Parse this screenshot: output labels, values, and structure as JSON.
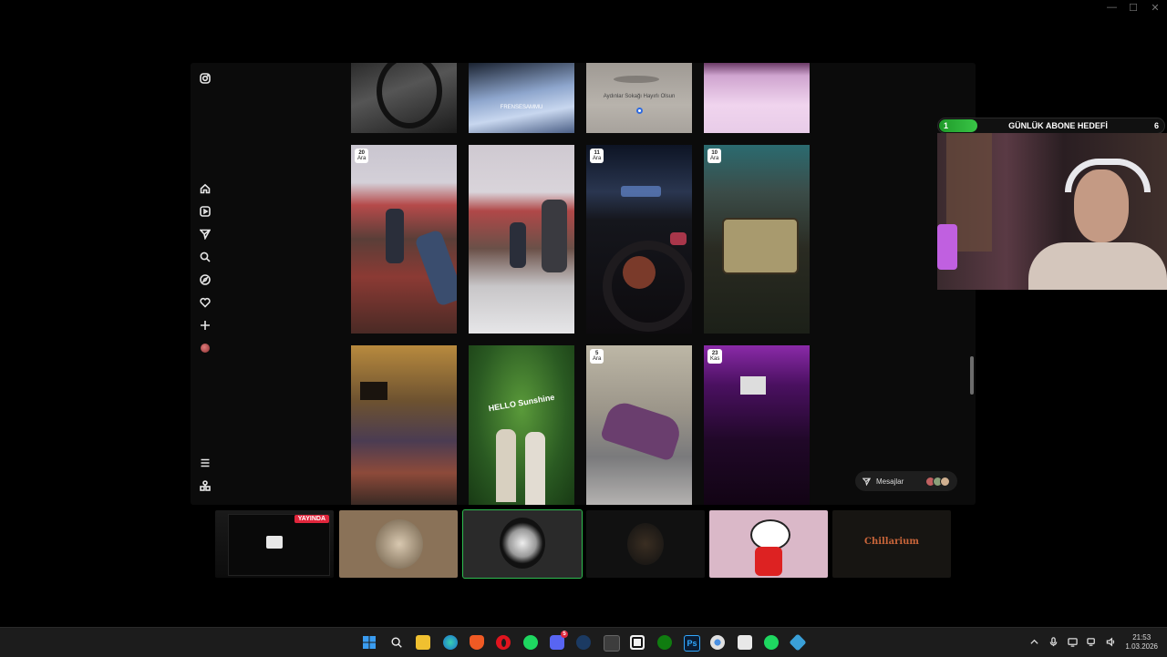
{
  "window_controls": {
    "minimize": "—",
    "maximize": "☐",
    "close": "✕"
  },
  "instagram": {
    "sidebar": {
      "logo_icon": "instagram-icon",
      "items": [
        {
          "icon": "home-icon"
        },
        {
          "icon": "reels-icon"
        },
        {
          "icon": "send-icon"
        },
        {
          "icon": "search-icon"
        },
        {
          "icon": "explore-icon"
        },
        {
          "icon": "heart-icon"
        },
        {
          "icon": "plus-icon"
        },
        {
          "icon": "profile-avatar"
        }
      ],
      "bottom": [
        {
          "icon": "menu-icon"
        },
        {
          "icon": "meta-icon"
        }
      ]
    },
    "posts": [
      {
        "caption": "",
        "date_day": "",
        "date_month": ""
      },
      {
        "caption": "FRENSESAMMU",
        "date_day": "",
        "date_month": ""
      },
      {
        "caption": "Aydınlar Sokağı Hayırlı Olsun",
        "date_day": "",
        "date_month": ""
      },
      {
        "caption": "",
        "date_day": "",
        "date_month": ""
      },
      {
        "caption": "",
        "date_day": "20",
        "date_month": "Ara"
      },
      {
        "caption": "",
        "date_day": "",
        "date_month": ""
      },
      {
        "caption": "",
        "date_day": "11",
        "date_month": "Ara"
      },
      {
        "caption": "",
        "date_day": "10",
        "date_month": "Ara"
      },
      {
        "caption": "",
        "date_day": "",
        "date_month": ""
      },
      {
        "caption": "HELLO Sunshine",
        "date_day": "",
        "date_month": ""
      },
      {
        "caption": "",
        "date_day": "5",
        "date_month": "Ara"
      },
      {
        "caption": "",
        "date_day": "23",
        "date_month": "Kas"
      }
    ],
    "messages": {
      "label": "Mesajlar",
      "icon": "send-icon"
    }
  },
  "webcam": {
    "subgoal": {
      "current": "1",
      "title": "GÜNLÜK ABONE HEDEFİ",
      "target": "6",
      "progress": 0.17
    }
  },
  "stream_thumbnails": [
    {
      "live_label": "YAYINDA",
      "selected": false,
      "text": ""
    },
    {
      "live_label": "",
      "selected": false,
      "text": ""
    },
    {
      "live_label": "",
      "selected": true,
      "text": ""
    },
    {
      "live_label": "",
      "selected": false,
      "text": ""
    },
    {
      "live_label": "",
      "selected": false,
      "text": ""
    },
    {
      "live_label": "",
      "selected": false,
      "text": "Chillarium"
    }
  ],
  "taskbar": {
    "apps": [
      "windows-start-icon",
      "search-icon",
      "file-explorer-icon",
      "edge-icon",
      "brave-icon",
      "opera-icon",
      "spotify-icon",
      "discord-icon",
      "steam-icon",
      "calculator-icon",
      "capcut-icon",
      "xbox-icon",
      "photoshop-icon",
      "chrome-icon",
      "taskmanager-icon",
      "spotify-icon",
      "store-icon"
    ],
    "discord_badge": "5",
    "tray": {
      "time": "21:53",
      "date": "1.03.2026"
    }
  }
}
